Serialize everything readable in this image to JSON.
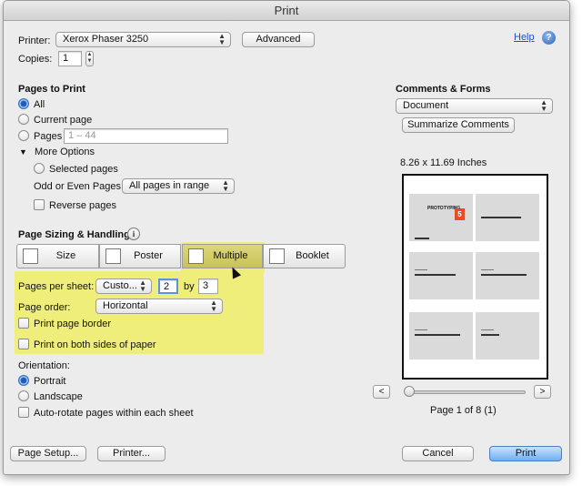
{
  "window": {
    "title": "Print"
  },
  "printer": {
    "label": "Printer:",
    "value": "Xerox Phaser 3250",
    "advanced_label": "Advanced"
  },
  "help": {
    "label": "Help",
    "glyph": "?"
  },
  "copies": {
    "label": "Copies:",
    "value": "1"
  },
  "pages_to_print": {
    "heading": "Pages to Print",
    "all_label": "All",
    "current_label": "Current page",
    "pages_label": "Pages",
    "pages_placeholder": "1 – 44",
    "more_options_label": "More Options",
    "selected_pages_label": "Selected pages",
    "odd_even_label": "Odd or Even Pages:",
    "odd_even_value": "All pages in range",
    "reverse_label": "Reverse pages"
  },
  "sizing": {
    "heading": "Page Sizing & Handling",
    "info_glyph": "i",
    "tabs": [
      {
        "label": "Size"
      },
      {
        "label": "Poster"
      },
      {
        "label": "Multiple"
      },
      {
        "label": "Booklet"
      }
    ]
  },
  "multiple": {
    "pages_per_sheet_label": "Pages per sheet:",
    "pages_per_sheet_value": "Custo...",
    "cols_value": "2",
    "by_label": "by",
    "rows_value": "3",
    "page_order_label": "Page order:",
    "page_order_value": "Horizontal",
    "border_label": "Print page border",
    "both_sides_label": "Print on both sides of paper"
  },
  "orientation": {
    "heading": "Orientation:",
    "portrait_label": "Portrait",
    "landscape_label": "Landscape",
    "autorotate_label": "Auto-rotate pages within each sheet"
  },
  "comments": {
    "heading": "Comments & Forms",
    "value": "Document",
    "summarize_label": "Summarize Comments"
  },
  "preview": {
    "size_label": "8.26 x 11.69 Inches",
    "page_label": "Page 1 of 8 (1)",
    "prev_glyph": "<",
    "next_glyph": ">",
    "thumb_text": "PROTOTYPING",
    "badge_glyph": "5",
    "badge_color": "#e44d26",
    "current_fraction": 0
  },
  "footer": {
    "page_setup_label": "Page Setup...",
    "printer_label": "Printer...",
    "cancel_label": "Cancel",
    "print_label": "Print"
  },
  "icons": {
    "popup_up": "▲",
    "popup_down": "▼",
    "disclosure": "▼"
  }
}
